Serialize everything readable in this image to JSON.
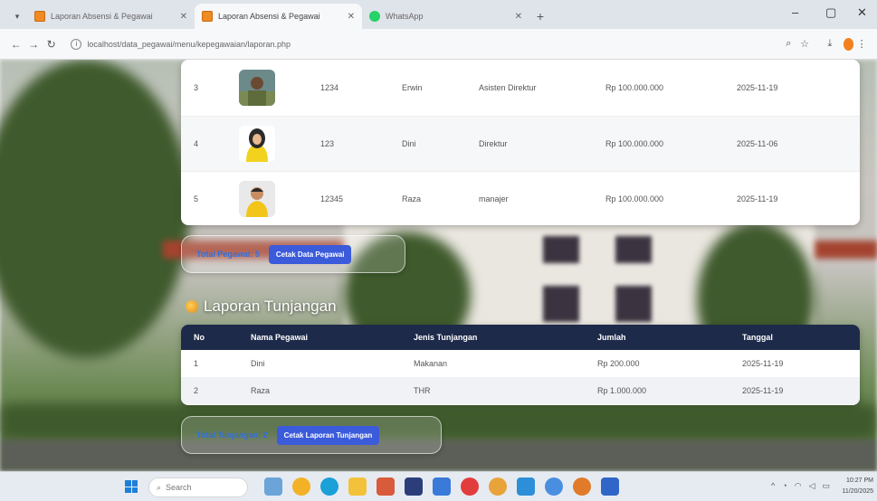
{
  "browser": {
    "tabs": [
      {
        "label": "Laporan Absensi & Pegawai",
        "active": false
      },
      {
        "label": "Laporan Absensi & Pegawai",
        "active": true
      },
      {
        "label": "WhatsApp",
        "active": false
      }
    ],
    "url": "localhost/data_pegawai/menu/kepegawaian/laporan.php"
  },
  "pegawai_table": {
    "rows": [
      {
        "no": "3",
        "nip": "1234",
        "nama": "Erwin",
        "jabatan": "Asisten Direktur",
        "gaji": "Rp 100.000.000",
        "tanggal": "2025-11-19"
      },
      {
        "no": "4",
        "nip": "123",
        "nama": "Dini",
        "jabatan": "Direktur",
        "gaji": "Rp 100.000.000",
        "tanggal": "2025-11-06"
      },
      {
        "no": "5",
        "nip": "12345",
        "nama": "Raza",
        "jabatan": "manajer",
        "gaji": "Rp 100.000.000",
        "tanggal": "2025-11-19"
      }
    ]
  },
  "pegawai_actions": {
    "total_label": "Total Pegawai: 5",
    "print_button": "Cetak Data Pegawai"
  },
  "tunjangan": {
    "title": "Laporan Tunjangan",
    "columns": [
      "No",
      "Nama Pegawai",
      "Jenis Tunjangan",
      "Jumlah",
      "Tanggal"
    ],
    "rows": [
      {
        "no": "1",
        "nama": "Dini",
        "jenis": "Makanan",
        "jumlah": "Rp 200.000",
        "tanggal": "2025-11-19"
      },
      {
        "no": "2",
        "nama": "Raza",
        "jenis": "THR",
        "jumlah": "Rp 1.000.000",
        "tanggal": "2025-11-19"
      }
    ],
    "total_label": "Total Tunjangan: 2",
    "print_button": "Cetak Laporan Tunjangan"
  },
  "taskbar": {
    "search_placeholder": "Search",
    "time": "10:27 PM",
    "date": "11/20/2025"
  },
  "colors": {
    "header_dark": "#1e2a4a",
    "button_blue": "#3b5bdb",
    "total_blue": "#2f6fe0",
    "profile_orange": "#f2811d"
  }
}
